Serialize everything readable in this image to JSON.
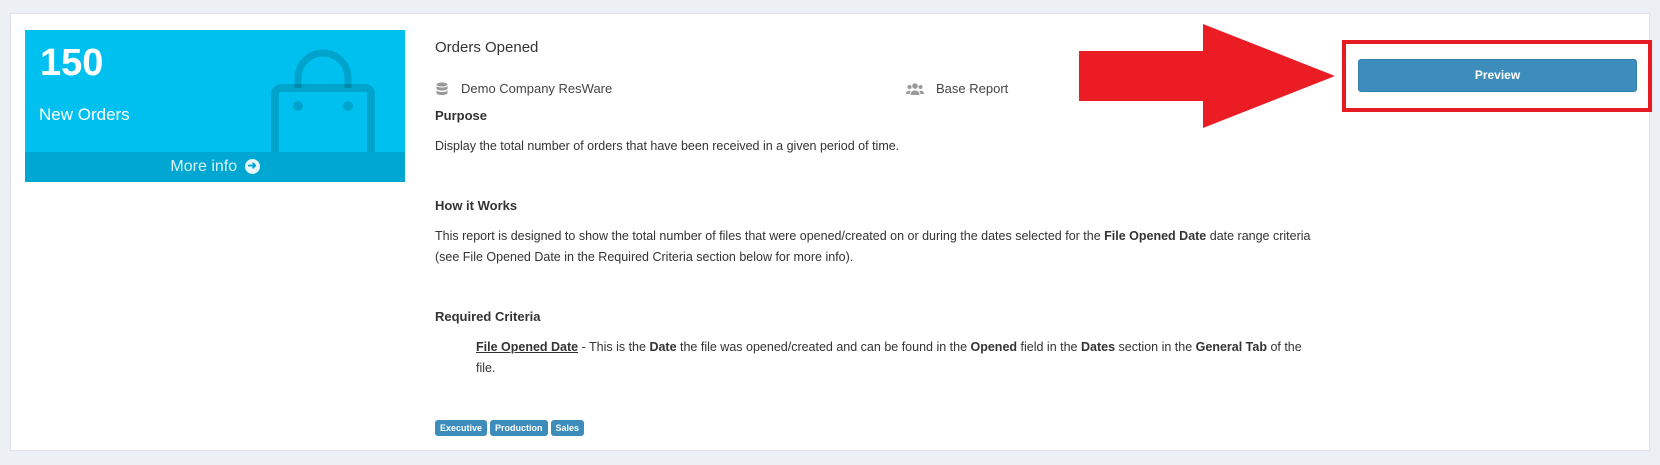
{
  "stat_box": {
    "number": "150",
    "label": "New Orders",
    "more_info": "More info",
    "background": "#00c0ef",
    "icon": "shopping-bag-icon"
  },
  "report": {
    "title": "Orders Opened",
    "company": "Demo Company ResWare",
    "company_icon": "database-icon",
    "type": "Base Report",
    "type_icon": "users-icon",
    "purpose_heading": "Purpose",
    "purpose_text": "Display the total number of orders that have been received in a given period of time.",
    "how_heading": "How it Works",
    "how_text_1": "This report is designed to show the total number of files that were opened/created on or during the dates selected for the ",
    "how_bold": "File Opened Date",
    "how_text_2": " date range criteria (see File Opened Date in the Required Criteria section below for more info).",
    "criteria_heading": "Required Criteria",
    "criteria": {
      "name": "File Opened Date",
      "t1": " - This is the ",
      "b1": "Date",
      "t2": " the file was opened/created and can be found in the ",
      "b2": "Opened",
      "t3": " field in the ",
      "b3": "Dates",
      "t4": " section in the ",
      "b4": "General Tab",
      "t5": " of the file."
    },
    "tags": [
      "Executive",
      "Production",
      "Sales"
    ]
  },
  "actions": {
    "preview_label": "Preview",
    "accent": "#3c8dbc",
    "highlight": "#e51c23"
  }
}
